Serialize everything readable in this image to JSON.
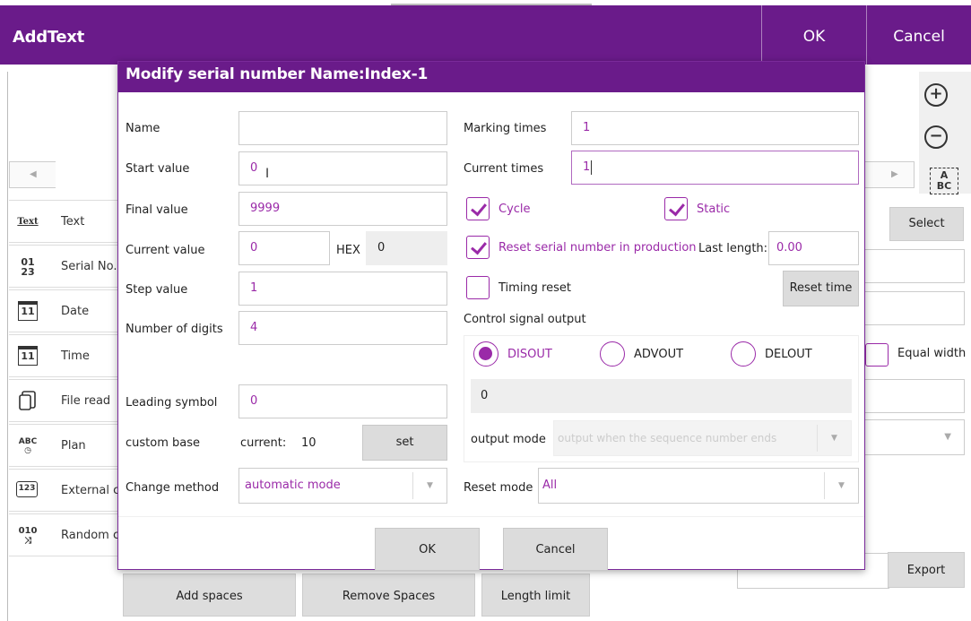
{
  "app": {
    "title": "AddText",
    "ok_label": "OK",
    "cancel_label": "Cancel"
  },
  "toolbar_right": {
    "zoom_in_icon": "zoom-in-icon",
    "zoom_out_icon": "zoom-out-icon",
    "abc_line1": "A",
    "abc_line2": "BC",
    "select_label": "Select",
    "equal_width_label": "Equal width",
    "export_label": "Export"
  },
  "tools": [
    {
      "icon": "Text",
      "label": "Text"
    },
    {
      "icon": "01/23",
      "label": "Serial No."
    },
    {
      "icon": "11",
      "label": "Date"
    },
    {
      "icon": "11",
      "label": "Time"
    },
    {
      "icon": "file",
      "label": "File read"
    },
    {
      "icon": "ABC",
      "label": "Plan"
    },
    {
      "icon": "123",
      "label": "External c"
    },
    {
      "icon": "010",
      "label": "Random c"
    }
  ],
  "bottom_buttons": {
    "add_spaces": "Add spaces",
    "remove_spaces": "Remove Spaces",
    "length_limit": "Length limit"
  },
  "dialog": {
    "title": "Modify serial number Name:Index-1",
    "left": {
      "name_label": "Name",
      "name_value": "",
      "start_value_label": "Start value",
      "start_value": "0",
      "final_value_label": "Final value",
      "final_value": "9999",
      "current_value_label": "Current  value",
      "current_value": "0",
      "hex_label": "HEX",
      "hex_value": "0",
      "step_value_label": "Step value",
      "step_value": "1",
      "digits_label": "Number of digits",
      "digits_value": "4",
      "leading_symbol_label": "Leading symbol",
      "leading_symbol_value": "0",
      "custom_base_label": "custom base",
      "current_base_label": "current:",
      "current_base_value": "10",
      "set_label": "set",
      "change_method_label": "Change method",
      "change_method_value": "automatic mode"
    },
    "right": {
      "marking_times_label": "Marking times",
      "marking_times_value": "1",
      "current_times_label": "Current times",
      "current_times_value": "1",
      "cycle_label": "Cycle",
      "cycle_checked": true,
      "static_label": "Static",
      "static_checked": true,
      "reset_in_production_label": "Reset serial number in production",
      "reset_in_production_checked": true,
      "last_length_label": "Last length:",
      "last_length_value": "0.00",
      "timing_reset_label": "Timing reset",
      "timing_reset_checked": false,
      "reset_time_label": "Reset time",
      "control_signal_label": "Control signal output",
      "radios": [
        {
          "label": "DISOUT",
          "selected": true
        },
        {
          "label": "ADVOUT",
          "selected": false
        },
        {
          "label": "DELOUT",
          "selected": false
        }
      ],
      "signal_value": "0",
      "output_mode_label": "output mode",
      "output_mode_value": "output when the sequence number ends",
      "reset_mode_label": "Reset mode",
      "reset_mode_value": "All"
    },
    "ok_label": "OK",
    "cancel_label": "Cancel"
  },
  "colors": {
    "brand_purple": "#6a1b8a",
    "accent_purple": "#9a2aa8",
    "button_gray": "#dcdcdc"
  }
}
